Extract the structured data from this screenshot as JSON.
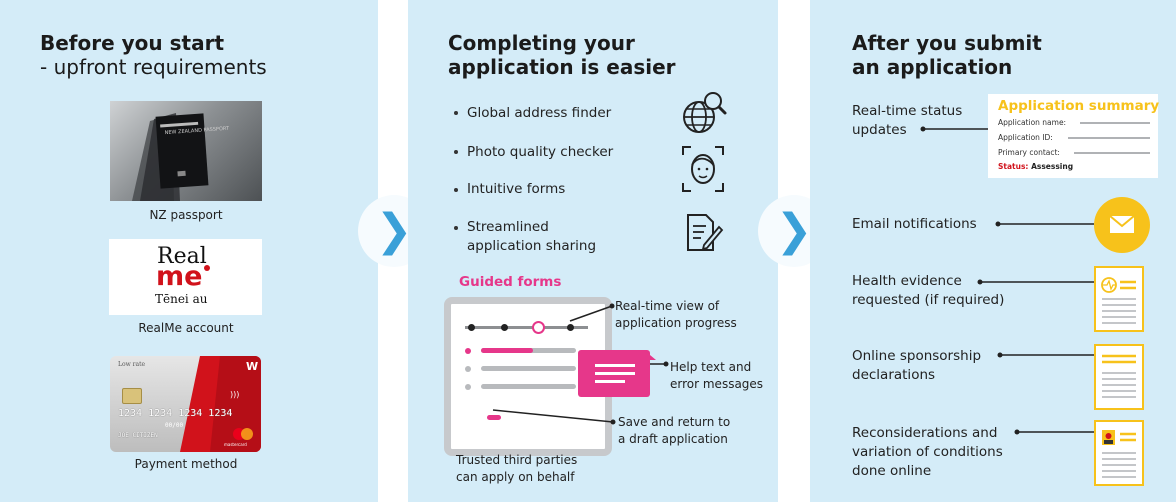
{
  "col1": {
    "title": "Before you start",
    "subtitle": "- upfront requirements",
    "passport_caption": "NZ passport",
    "passport_cover_text": "NEW ZEALAND PASSPORT",
    "realme_caption": "RealMe account",
    "realme_logo_real": "Real",
    "realme_logo_me": "me",
    "realme_logo_sub": "Tēnei au",
    "card_caption": "Payment method",
    "card_bank": "Low rate",
    "card_number": "1234  1234  1234  1234",
    "card_expiry": "00/00",
    "card_holder": "JOE CITIZEN",
    "card_brand": "mastercard"
  },
  "col2": {
    "title_line1": "Completing your",
    "title_line2": "application is easier",
    "bullets": [
      {
        "line1": "Global address finder",
        "line2": "",
        "icon": "globe-search-icon"
      },
      {
        "line1": "Photo quality checker",
        "line2": "",
        "icon": "face-scan-icon"
      },
      {
        "line1": "Intuitive forms",
        "line2": "",
        "icon": ""
      },
      {
        "line1": "Streamlined",
        "line2": "application sharing",
        "icon": "document-edit-icon"
      }
    ],
    "guided_forms_label": "Guided forms",
    "callout_progress_1": "Real-time view of",
    "callout_progress_2": "application progress",
    "callout_help_1": "Help text and",
    "callout_help_2": "error messages",
    "callout_save_1": "Save and return to",
    "callout_save_2": "a draft application",
    "third_party_1": "Trusted third parties",
    "third_party_2": "can apply on behalf"
  },
  "col3": {
    "title_line1": "After you submit",
    "title_line2": "an application",
    "status_1": "Real-time status",
    "status_2": "updates",
    "summary_title": "Application summary",
    "summary_name": "Application name:",
    "summary_id": "Application ID:",
    "summary_contact": "Primary contact:",
    "summary_status_label": "Status:",
    "summary_status_value": "Assessing",
    "email": "Email notifications",
    "health_1": "Health evidence",
    "health_2": "requested (if required)",
    "sponsor_1": "Online sponsorship",
    "sponsor_2": "declarations",
    "recon_1": "Reconsiderations and",
    "recon_2": "variation of conditions",
    "recon_3": "done online"
  },
  "colors": {
    "panel": "#d4ecf8",
    "accent_blue": "#3aa0d8",
    "pink": "#e6378a",
    "yellow": "#f7c21b",
    "red": "#d1121b"
  }
}
